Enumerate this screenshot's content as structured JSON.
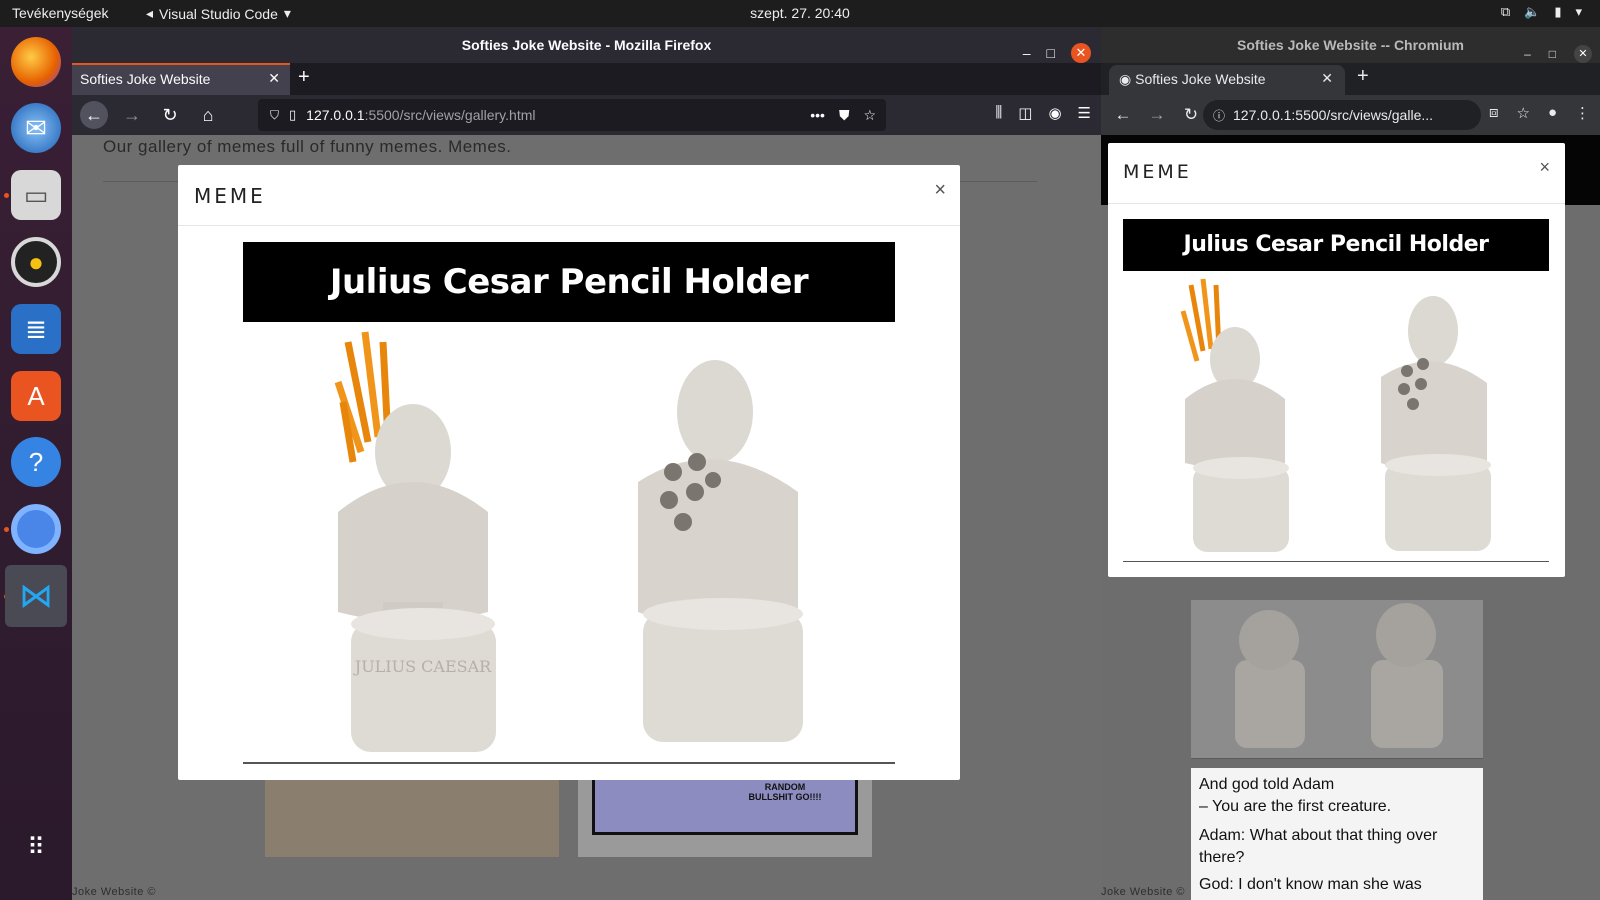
{
  "topbar": {
    "activities": "Tevékenységek",
    "app_name": "Visual Studio Code",
    "clock": "szept. 27.  20:40"
  },
  "dock": {
    "items": [
      "firefox-icon",
      "thunderbird-icon",
      "files-icon",
      "rhythmbox-icon",
      "writer-icon",
      "software-icon",
      "help-icon",
      "chromium-icon",
      "vscode-icon",
      "app-grid-icon"
    ]
  },
  "firefox": {
    "window_title": "Softies Joke Website - Mozilla Firefox",
    "tab_title": "Softies Joke Website",
    "url_host": "127.0.0.1",
    "url_path": ":5500/src/views/gallery.html",
    "page": {
      "description": "Our gallery of memes full of funny memes. Memes.",
      "footer": "Joke Website ©"
    },
    "modal": {
      "title": "MEME",
      "close": "×",
      "meme_caption": "Julius Cesar Pencil Holder",
      "bust_engraving": "JULIUS CAESAR"
    },
    "comic_text": "RANDOM BULLSHIT GO!!!!"
  },
  "chromium": {
    "window_title": "Softies Joke Website -- Chromium",
    "tab_title": "Softies Joke Website",
    "url": "127.0.0.1:5500/src/views/galle...",
    "modal": {
      "title": "MEME",
      "close": "×",
      "meme_caption": "Julius Cesar Pencil Holder"
    },
    "joke": {
      "line1": "And god told Adam",
      "line2": "– You are the first creature.",
      "line3": "Adam: What about that thing over there?",
      "line4": "God: I don't know man she was"
    },
    "footer": "Joke Website ©"
  },
  "colors": {
    "ubuntu_orange": "#e95420",
    "firefox_chrome": "#2b2a33",
    "chromium_chrome": "#35363a",
    "overlay": "#6e6e6e",
    "modal_bg": "#ffffff"
  }
}
